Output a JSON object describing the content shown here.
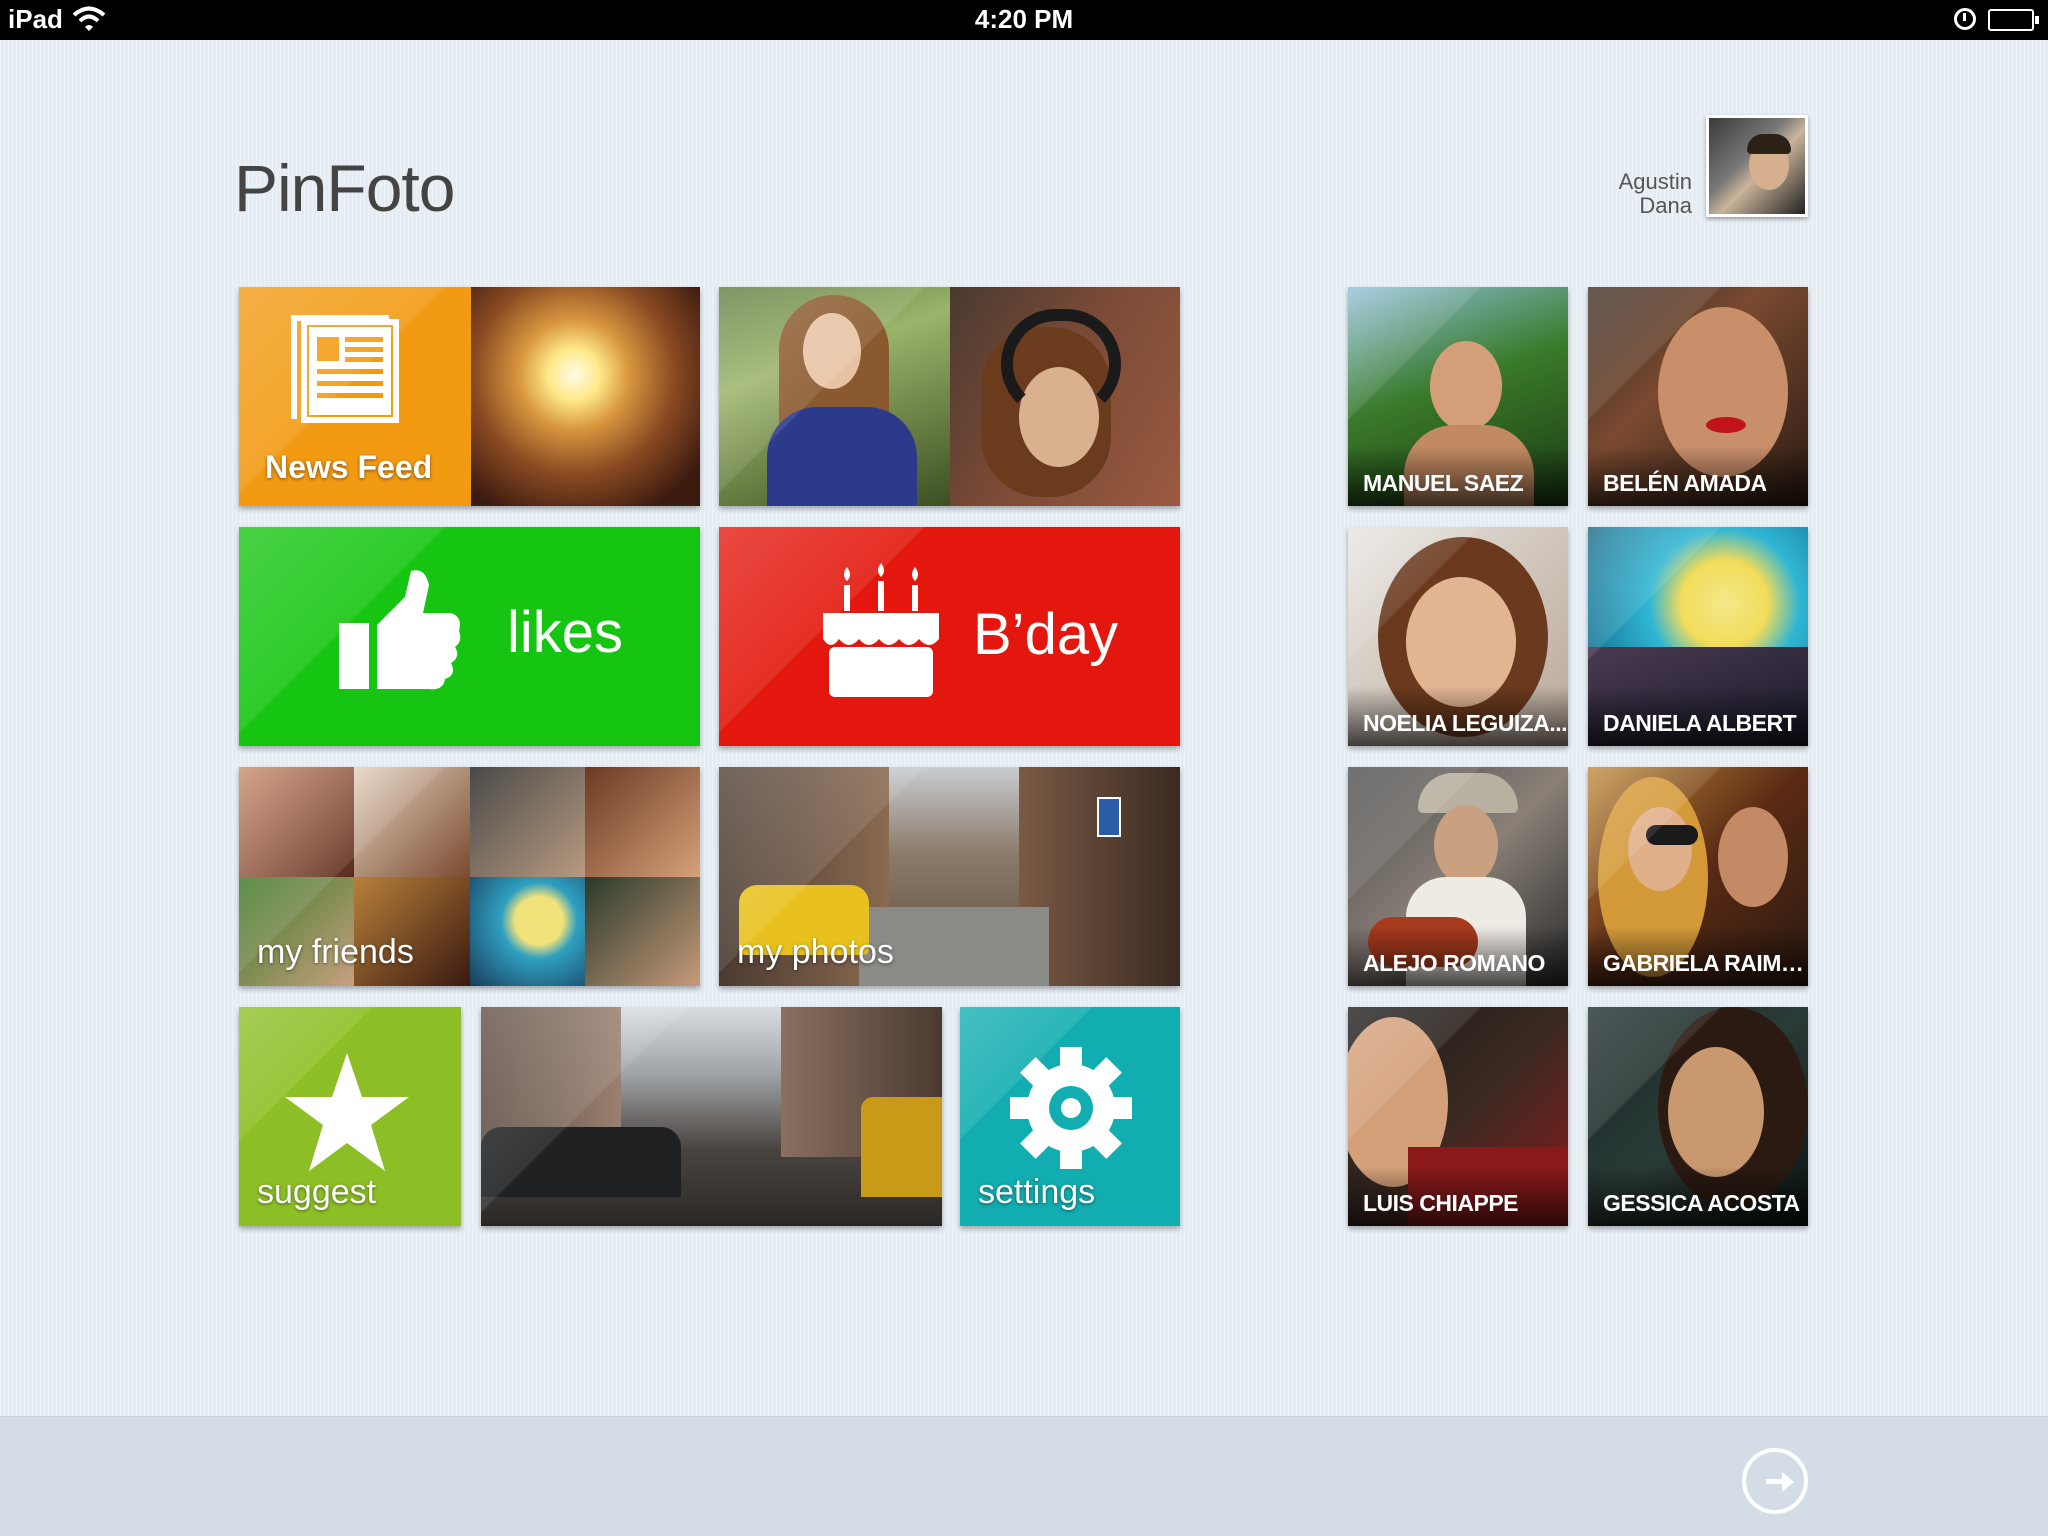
{
  "status_bar": {
    "device": "iPad",
    "time": "4:20 PM",
    "battery_level": 1.0
  },
  "app": {
    "title": "PinFoto"
  },
  "user": {
    "first_name": "Agustin",
    "last_name": "Dana"
  },
  "tiles": {
    "news_feed": {
      "label": "News Feed",
      "color": "#f29a12",
      "icon": "newspaper-icon"
    },
    "likes": {
      "label": "likes",
      "color": "#16c512",
      "icon": "thumbs-up-icon"
    },
    "birthday": {
      "label": "B’day",
      "color": "#e3170d",
      "icon": "cake-icon"
    },
    "my_friends": {
      "label": "my friends"
    },
    "my_photos": {
      "label": "my photos"
    },
    "suggest": {
      "label": "suggest",
      "color": "#8cbf26",
      "icon": "star-icon"
    },
    "settings": {
      "label": "settings",
      "color": "#12adb0",
      "icon": "gear-icon"
    }
  },
  "friends": [
    {
      "name": "MANUEL SAEZ"
    },
    {
      "name": "BELÉN AMADA"
    },
    {
      "name": "NOELIA LEGUIZA..."
    },
    {
      "name": "DANIELA ALBERT"
    },
    {
      "name": "ALEJO ROMANO"
    },
    {
      "name": "GABRIELA RAIMO..."
    },
    {
      "name": "LUIS CHIAPPE"
    },
    {
      "name": "GESSICA ACOSTA"
    }
  ],
  "bottom_bar": {
    "icon": "logout-icon"
  }
}
